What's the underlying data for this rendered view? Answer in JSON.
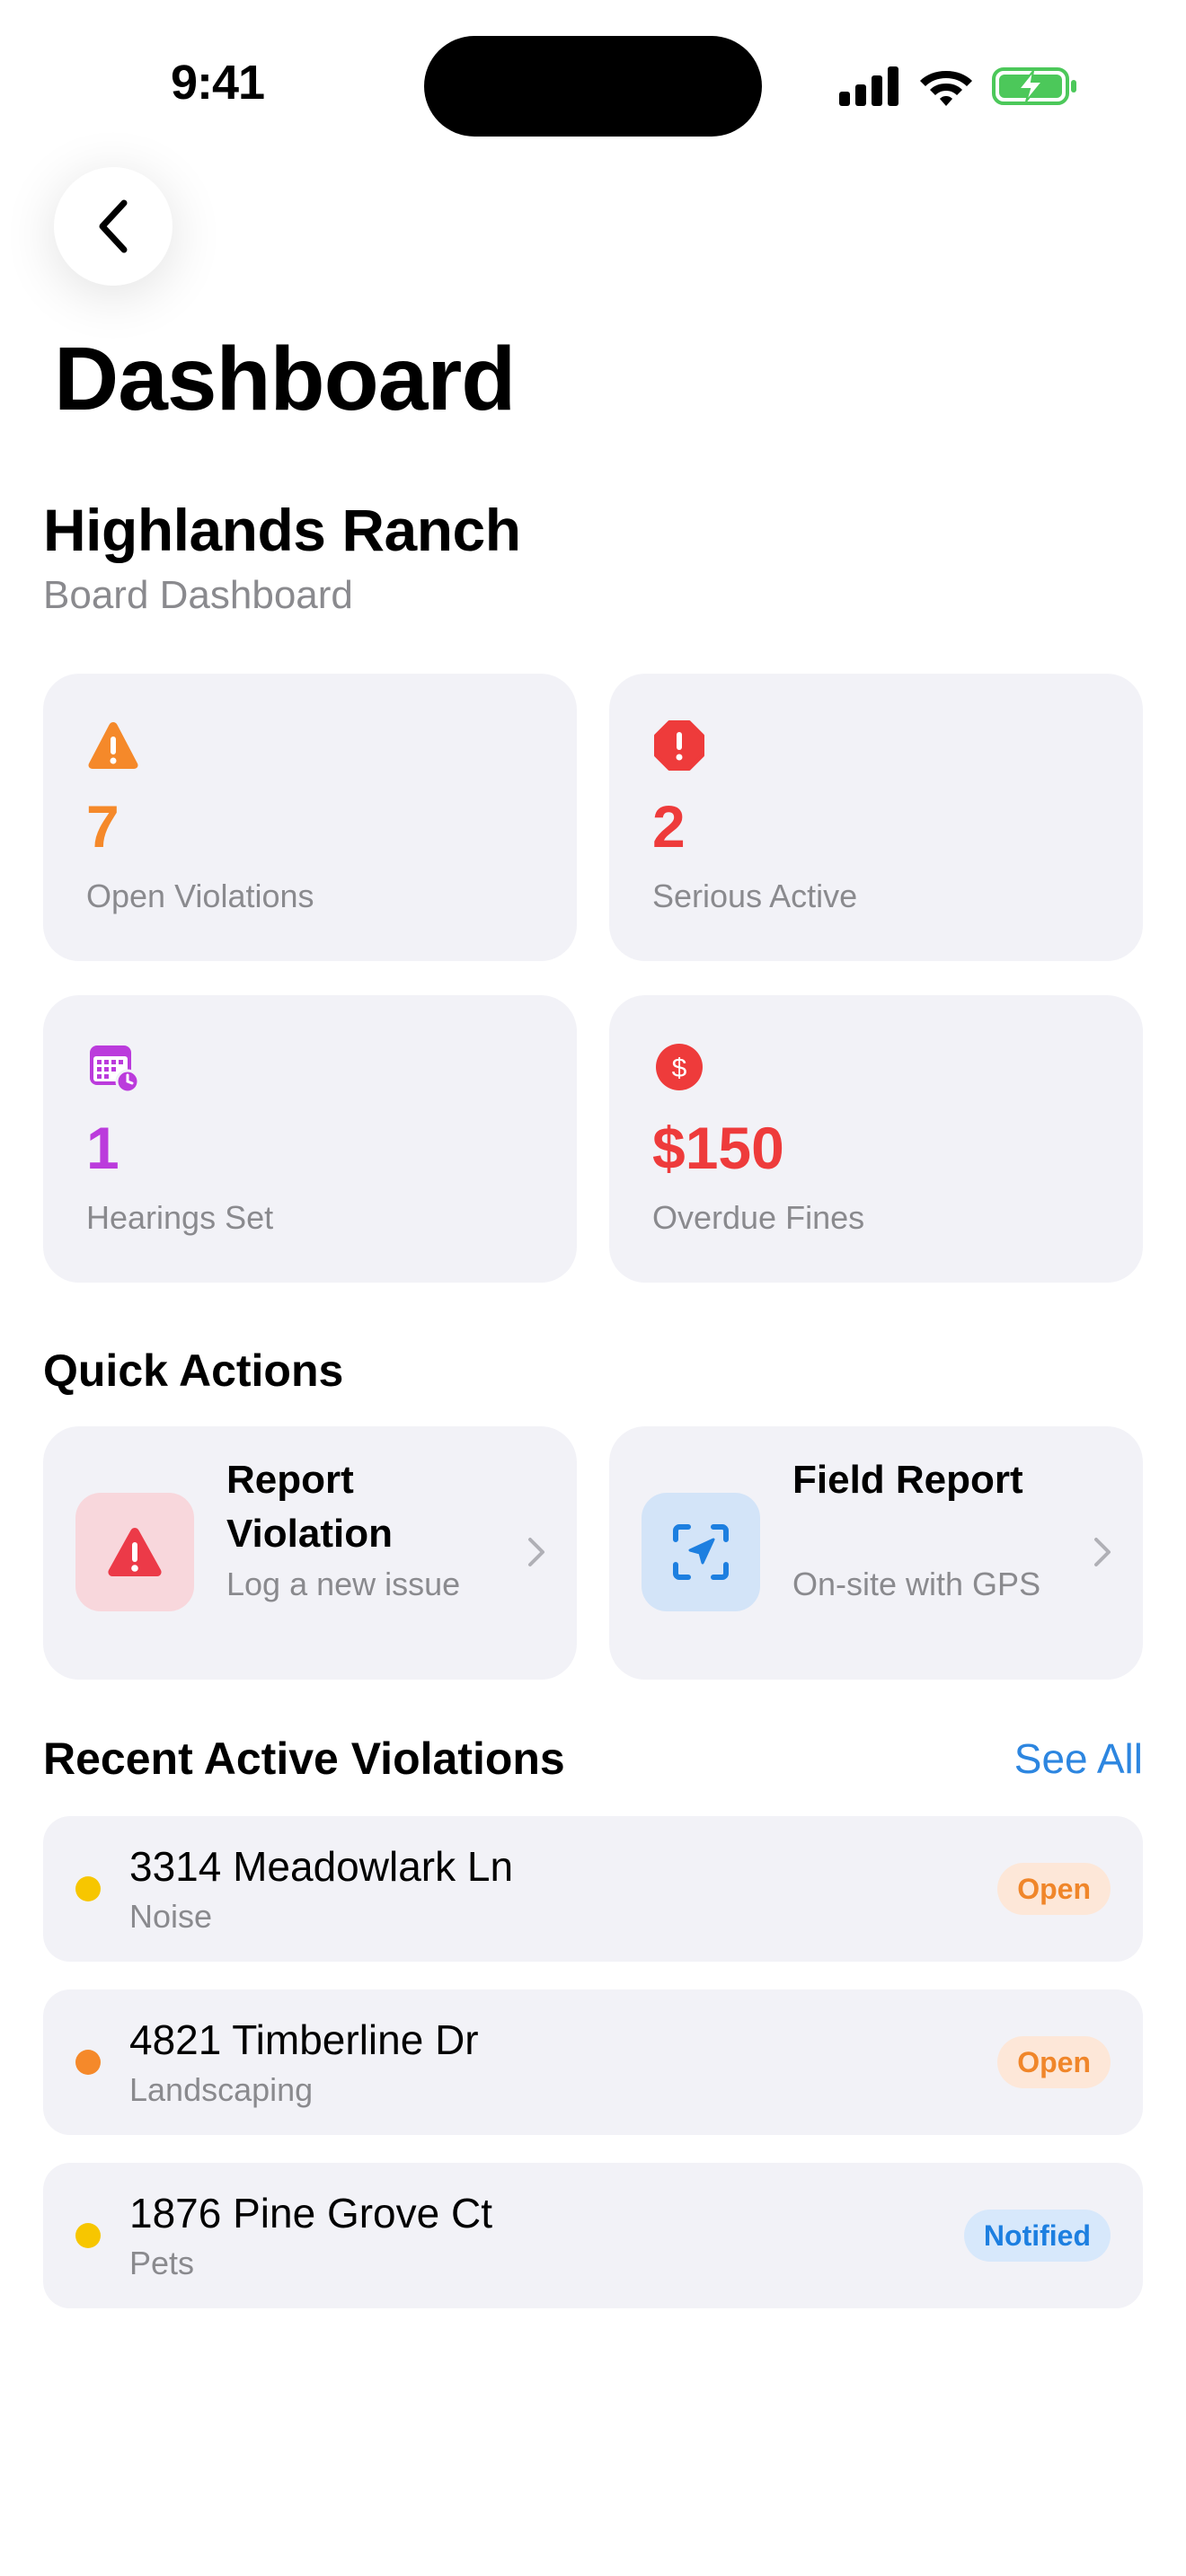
{
  "status_bar": {
    "time": "9:41"
  },
  "header": {
    "back_icon": "chevron-left-icon",
    "title": "Dashboard"
  },
  "community": {
    "name": "Highlands Ranch",
    "subtitle": "Board Dashboard"
  },
  "stats": [
    {
      "value": "7",
      "label": "Open Violations",
      "icon": "warning-triangle-icon",
      "color": "#f5892a"
    },
    {
      "value": "2",
      "label": "Serious Active",
      "icon": "octagon-alert-icon",
      "color": "#ee3b3b"
    },
    {
      "value": "1",
      "label": "Hearings Set",
      "icon": "calendar-clock-icon",
      "color": "#bb3bdc"
    },
    {
      "value": "$150",
      "label": "Overdue Fines",
      "icon": "dollar-circle-icon",
      "color": "#ee3b3b"
    }
  ],
  "quick_actions": {
    "title": "Quick Actions",
    "items": [
      {
        "title": "Report Violation",
        "subtitle": "Log a new issue",
        "icon": "warning-triangle-icon",
        "icon_bg": "#f8d7dc",
        "icon_color": "#ec3a48"
      },
      {
        "title": "Field Report",
        "subtitle": "On-site with GPS",
        "icon": "location-arrow-scan-icon",
        "icon_bg": "#d3e4f8",
        "icon_color": "#1d7fe0"
      }
    ]
  },
  "recent": {
    "title": "Recent Active Violations",
    "see_all": "See All",
    "items": [
      {
        "address": "3314 Meadowlark Ln",
        "category": "Noise",
        "status": "Open",
        "dot_color": "#f7c600"
      },
      {
        "address": "4821 Timberline Dr",
        "category": "Landscaping",
        "status": "Open",
        "dot_color": "#f5892a"
      },
      {
        "address": "1876 Pine Grove Ct",
        "category": "Pets",
        "status": "Notified",
        "dot_color": "#f7c600"
      }
    ]
  }
}
